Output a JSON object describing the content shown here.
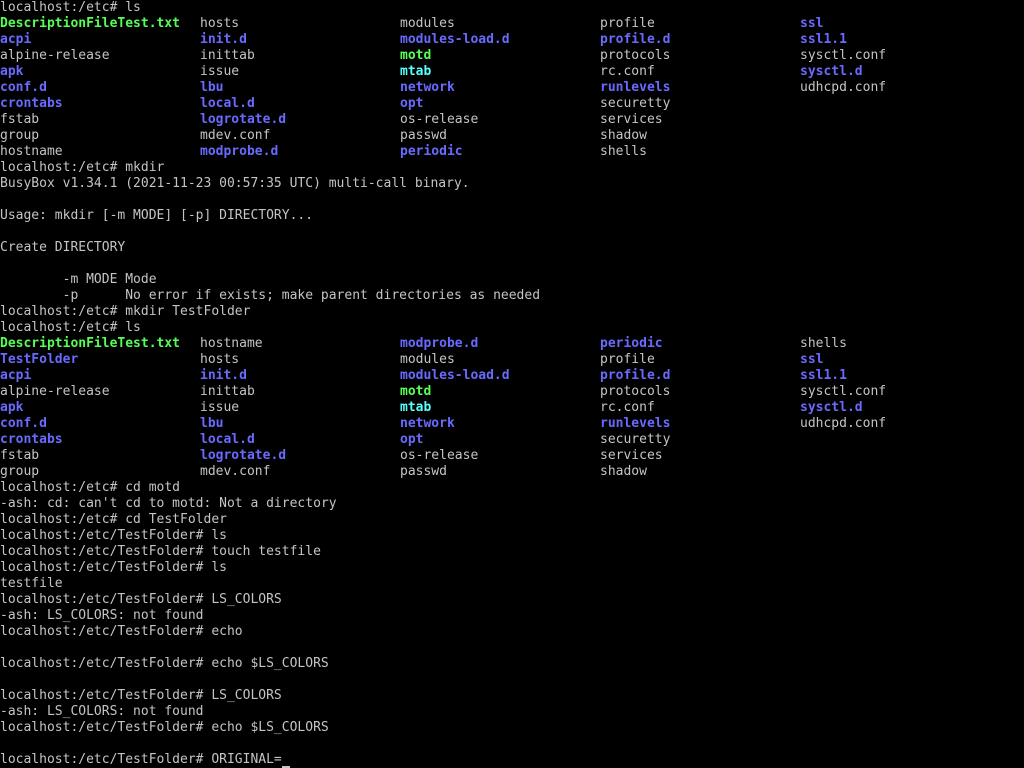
{
  "colors": {
    "background": "#000000",
    "text": "#c4c4c4",
    "directory": "#6a6aff",
    "symlink": "#55ffff",
    "executable": "#55ff55"
  },
  "lines": [
    {
      "type": "text",
      "text": "localhost:/etc# ls"
    },
    {
      "type": "grid",
      "cells": [
        {
          "text": "DescriptionFileTest.txt",
          "kind": "exec"
        },
        {
          "text": "hosts",
          "kind": "file"
        },
        {
          "text": "modules",
          "kind": "file"
        },
        {
          "text": "profile",
          "kind": "file"
        },
        {
          "text": "ssl",
          "kind": "dir"
        }
      ]
    },
    {
      "type": "grid",
      "cells": [
        {
          "text": "acpi",
          "kind": "dir"
        },
        {
          "text": "init.d",
          "kind": "dir"
        },
        {
          "text": "modules-load.d",
          "kind": "dir"
        },
        {
          "text": "profile.d",
          "kind": "dir"
        },
        {
          "text": "ssl1.1",
          "kind": "dir"
        }
      ]
    },
    {
      "type": "grid",
      "cells": [
        {
          "text": "alpine-release",
          "kind": "file"
        },
        {
          "text": "inittab",
          "kind": "file"
        },
        {
          "text": "motd",
          "kind": "exec"
        },
        {
          "text": "protocols",
          "kind": "file"
        },
        {
          "text": "sysctl.conf",
          "kind": "file"
        }
      ]
    },
    {
      "type": "grid",
      "cells": [
        {
          "text": "apk",
          "kind": "dir"
        },
        {
          "text": "issue",
          "kind": "file"
        },
        {
          "text": "mtab",
          "kind": "link"
        },
        {
          "text": "rc.conf",
          "kind": "file"
        },
        {
          "text": "sysctl.d",
          "kind": "dir"
        }
      ]
    },
    {
      "type": "grid",
      "cells": [
        {
          "text": "conf.d",
          "kind": "dir"
        },
        {
          "text": "lbu",
          "kind": "dir"
        },
        {
          "text": "network",
          "kind": "dir"
        },
        {
          "text": "runlevels",
          "kind": "dir"
        },
        {
          "text": "udhcpd.conf",
          "kind": "file"
        }
      ]
    },
    {
      "type": "grid",
      "cells": [
        {
          "text": "crontabs",
          "kind": "dir"
        },
        {
          "text": "local.d",
          "kind": "dir"
        },
        {
          "text": "opt",
          "kind": "dir"
        },
        {
          "text": "securetty",
          "kind": "file"
        },
        {
          "text": "",
          "kind": "file"
        }
      ]
    },
    {
      "type": "grid",
      "cells": [
        {
          "text": "fstab",
          "kind": "file"
        },
        {
          "text": "logrotate.d",
          "kind": "dir"
        },
        {
          "text": "os-release",
          "kind": "file"
        },
        {
          "text": "services",
          "kind": "file"
        },
        {
          "text": "",
          "kind": "file"
        }
      ]
    },
    {
      "type": "grid",
      "cells": [
        {
          "text": "group",
          "kind": "file"
        },
        {
          "text": "mdev.conf",
          "kind": "file"
        },
        {
          "text": "passwd",
          "kind": "file"
        },
        {
          "text": "shadow",
          "kind": "file"
        },
        {
          "text": "",
          "kind": "file"
        }
      ]
    },
    {
      "type": "grid",
      "cells": [
        {
          "text": "hostname",
          "kind": "file"
        },
        {
          "text": "modprobe.d",
          "kind": "dir"
        },
        {
          "text": "periodic",
          "kind": "dir"
        },
        {
          "text": "shells",
          "kind": "file"
        },
        {
          "text": "",
          "kind": "file"
        }
      ]
    },
    {
      "type": "text",
      "text": "localhost:/etc# mkdir"
    },
    {
      "type": "text",
      "text": "BusyBox v1.34.1 (2021-11-23 00:57:35 UTC) multi-call binary."
    },
    {
      "type": "text",
      "text": ""
    },
    {
      "type": "text",
      "text": "Usage: mkdir [-m MODE] [-p] DIRECTORY..."
    },
    {
      "type": "text",
      "text": ""
    },
    {
      "type": "text",
      "text": "Create DIRECTORY"
    },
    {
      "type": "text",
      "text": ""
    },
    {
      "type": "text",
      "text": "        -m MODE Mode"
    },
    {
      "type": "text",
      "text": "        -p      No error if exists; make parent directories as needed"
    },
    {
      "type": "text",
      "text": "localhost:/etc# mkdir TestFolder"
    },
    {
      "type": "text",
      "text": "localhost:/etc# ls"
    },
    {
      "type": "grid",
      "cells": [
        {
          "text": "DescriptionFileTest.txt",
          "kind": "exec"
        },
        {
          "text": "hostname",
          "kind": "file"
        },
        {
          "text": "modprobe.d",
          "kind": "dir"
        },
        {
          "text": "periodic",
          "kind": "dir"
        },
        {
          "text": "shells",
          "kind": "file"
        }
      ]
    },
    {
      "type": "grid",
      "cells": [
        {
          "text": "TestFolder",
          "kind": "dir"
        },
        {
          "text": "hosts",
          "kind": "file"
        },
        {
          "text": "modules",
          "kind": "file"
        },
        {
          "text": "profile",
          "kind": "file"
        },
        {
          "text": "ssl",
          "kind": "dir"
        }
      ]
    },
    {
      "type": "grid",
      "cells": [
        {
          "text": "acpi",
          "kind": "dir"
        },
        {
          "text": "init.d",
          "kind": "dir"
        },
        {
          "text": "modules-load.d",
          "kind": "dir"
        },
        {
          "text": "profile.d",
          "kind": "dir"
        },
        {
          "text": "ssl1.1",
          "kind": "dir"
        }
      ]
    },
    {
      "type": "grid",
      "cells": [
        {
          "text": "alpine-release",
          "kind": "file"
        },
        {
          "text": "inittab",
          "kind": "file"
        },
        {
          "text": "motd",
          "kind": "exec"
        },
        {
          "text": "protocols",
          "kind": "file"
        },
        {
          "text": "sysctl.conf",
          "kind": "file"
        }
      ]
    },
    {
      "type": "grid",
      "cells": [
        {
          "text": "apk",
          "kind": "dir"
        },
        {
          "text": "issue",
          "kind": "file"
        },
        {
          "text": "mtab",
          "kind": "link"
        },
        {
          "text": "rc.conf",
          "kind": "file"
        },
        {
          "text": "sysctl.d",
          "kind": "dir"
        }
      ]
    },
    {
      "type": "grid",
      "cells": [
        {
          "text": "conf.d",
          "kind": "dir"
        },
        {
          "text": "lbu",
          "kind": "dir"
        },
        {
          "text": "network",
          "kind": "dir"
        },
        {
          "text": "runlevels",
          "kind": "dir"
        },
        {
          "text": "udhcpd.conf",
          "kind": "file"
        }
      ]
    },
    {
      "type": "grid",
      "cells": [
        {
          "text": "crontabs",
          "kind": "dir"
        },
        {
          "text": "local.d",
          "kind": "dir"
        },
        {
          "text": "opt",
          "kind": "dir"
        },
        {
          "text": "securetty",
          "kind": "file"
        },
        {
          "text": "",
          "kind": "file"
        }
      ]
    },
    {
      "type": "grid",
      "cells": [
        {
          "text": "fstab",
          "kind": "file"
        },
        {
          "text": "logrotate.d",
          "kind": "dir"
        },
        {
          "text": "os-release",
          "kind": "file"
        },
        {
          "text": "services",
          "kind": "file"
        },
        {
          "text": "",
          "kind": "file"
        }
      ]
    },
    {
      "type": "grid",
      "cells": [
        {
          "text": "group",
          "kind": "file"
        },
        {
          "text": "mdev.conf",
          "kind": "file"
        },
        {
          "text": "passwd",
          "kind": "file"
        },
        {
          "text": "shadow",
          "kind": "file"
        },
        {
          "text": "",
          "kind": "file"
        }
      ]
    },
    {
      "type": "text",
      "text": "localhost:/etc# cd motd"
    },
    {
      "type": "text",
      "text": "-ash: cd: can't cd to motd: Not a directory"
    },
    {
      "type": "text",
      "text": "localhost:/etc# cd TestFolder"
    },
    {
      "type": "text",
      "text": "localhost:/etc/TestFolder# ls"
    },
    {
      "type": "text",
      "text": "localhost:/etc/TestFolder# touch testfile"
    },
    {
      "type": "text",
      "text": "localhost:/etc/TestFolder# ls"
    },
    {
      "type": "text",
      "text": "testfile"
    },
    {
      "type": "text",
      "text": "localhost:/etc/TestFolder# LS_COLORS"
    },
    {
      "type": "text",
      "text": "-ash: LS_COLORS: not found"
    },
    {
      "type": "text",
      "text": "localhost:/etc/TestFolder# echo"
    },
    {
      "type": "text",
      "text": ""
    },
    {
      "type": "text",
      "text": "localhost:/etc/TestFolder# echo $LS_COLORS"
    },
    {
      "type": "text",
      "text": ""
    },
    {
      "type": "text",
      "text": "localhost:/etc/TestFolder# LS_COLORS"
    },
    {
      "type": "text",
      "text": "-ash: LS_COLORS: not found"
    },
    {
      "type": "text",
      "text": "localhost:/etc/TestFolder# echo $LS_COLORS"
    },
    {
      "type": "text",
      "text": ""
    },
    {
      "type": "prompt",
      "text": "localhost:/etc/TestFolder# ORIGINAL="
    }
  ]
}
